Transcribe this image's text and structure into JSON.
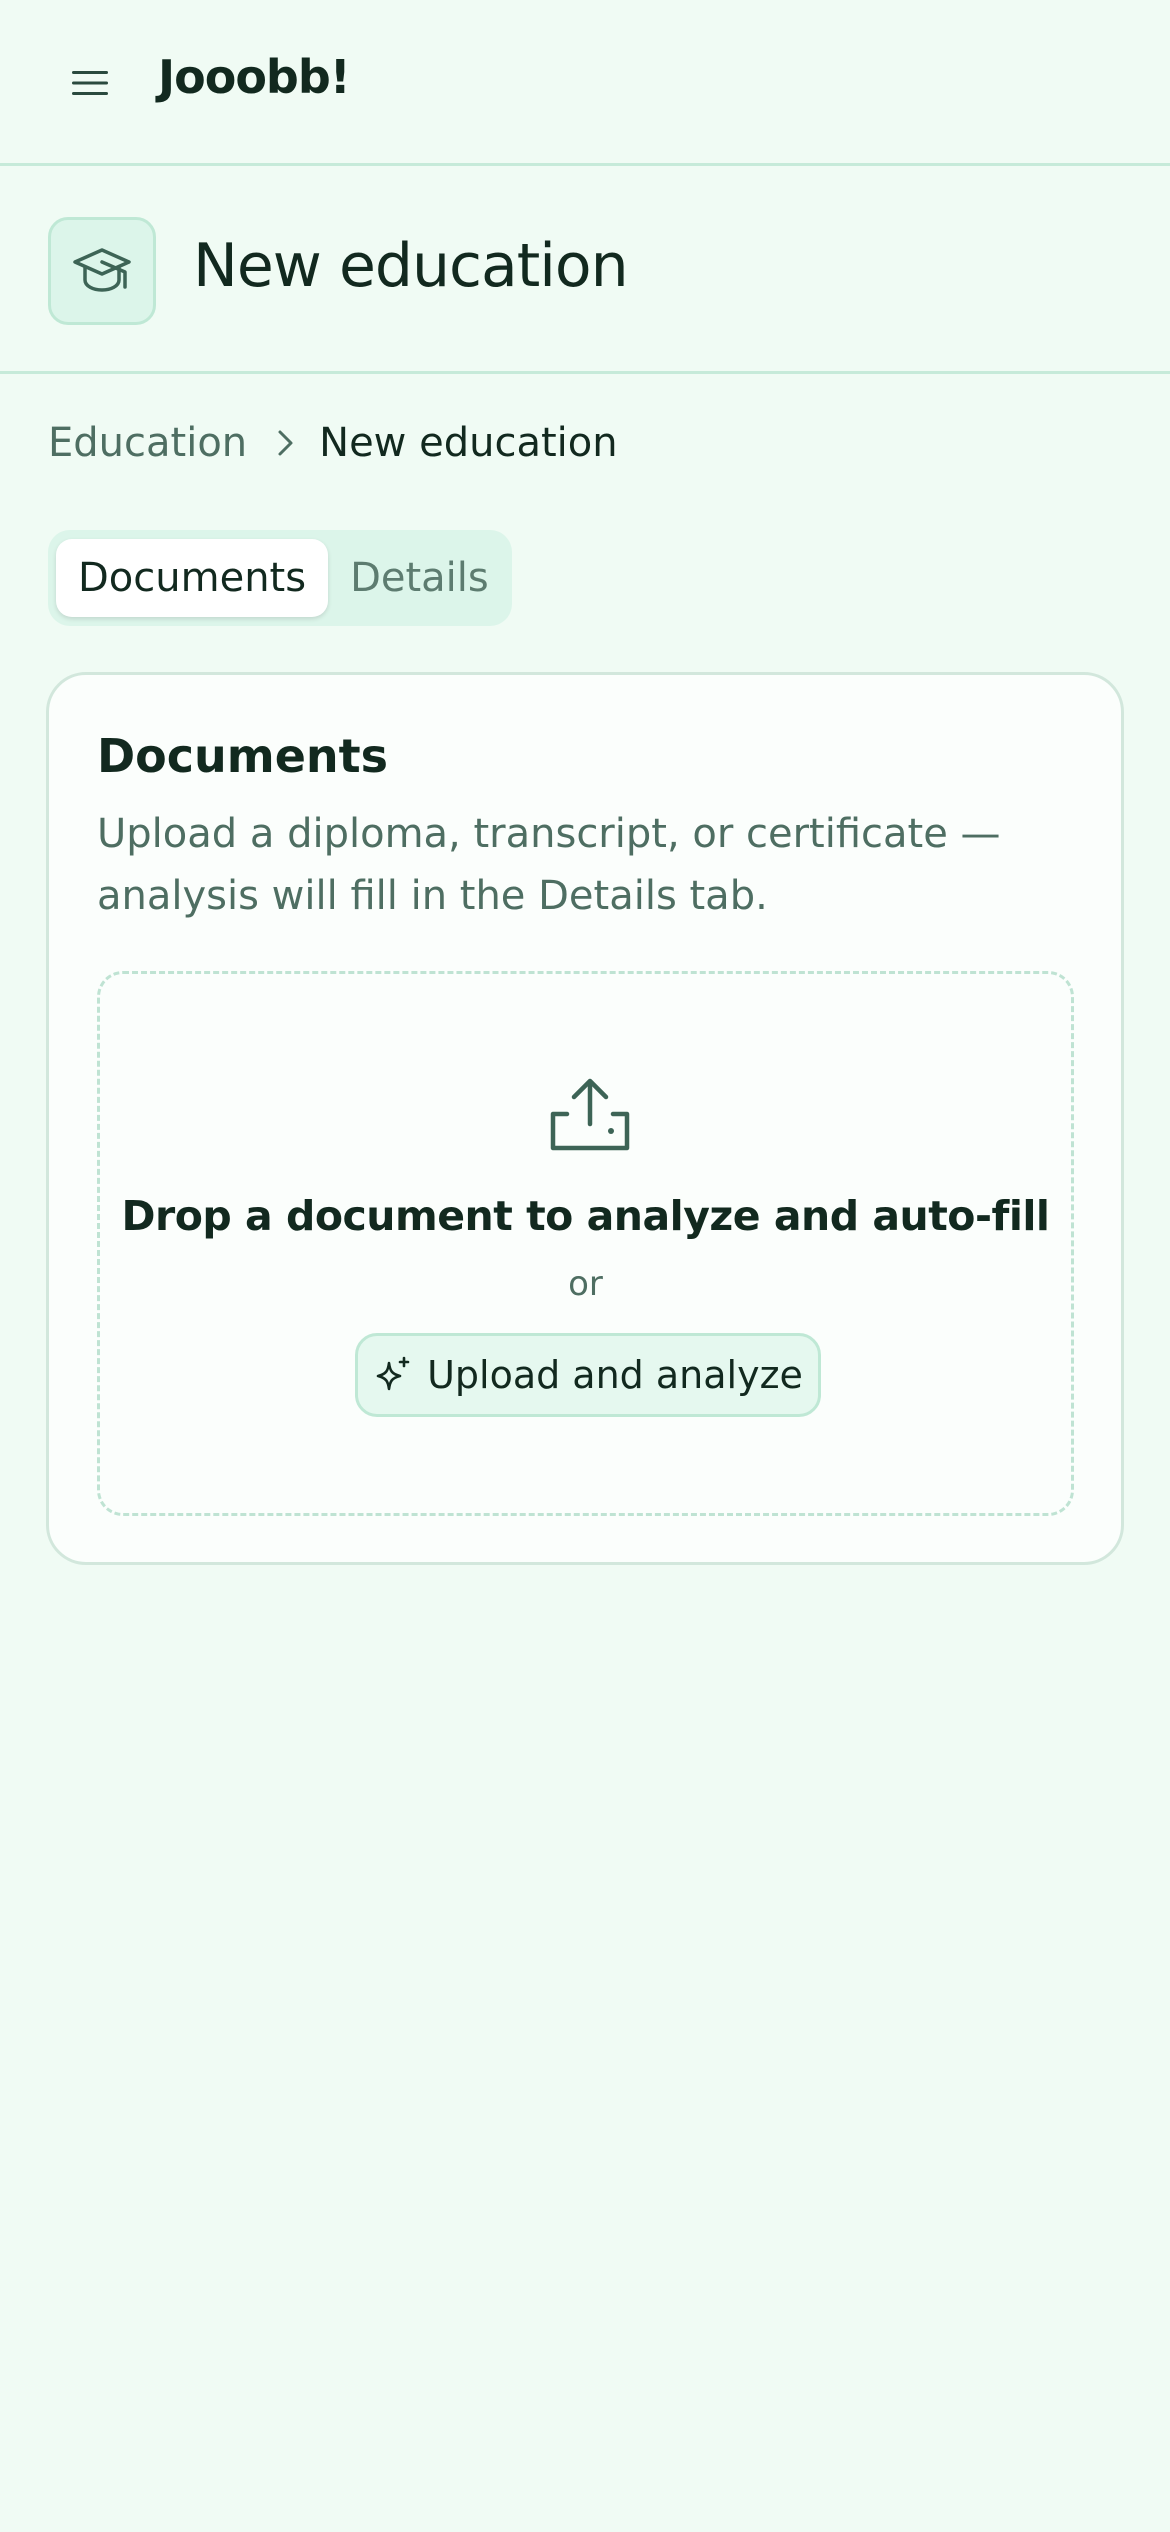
{
  "app": {
    "name": "Jooobb!",
    "menu_icon": "hamburger-menu-icon"
  },
  "header": {
    "icon": "graduation-cap-icon",
    "title": "New education"
  },
  "breadcrumb": {
    "parent": "Education",
    "separator_icon": "chevron-right-icon",
    "current": "New education"
  },
  "tabs": [
    {
      "label": "Documents",
      "active": true
    },
    {
      "label": "Details",
      "active": false
    }
  ],
  "documents_card": {
    "title": "Documents",
    "description": "Upload a diploma, transcript, or certificate — analysis will fill in the Details tab.",
    "dropzone": {
      "icon": "upload-icon",
      "title": "Drop a document to analyze and auto-fill",
      "or_text": "or",
      "button_icon": "sparkle-icon",
      "button_label": "Upload and analyze"
    }
  },
  "colors": {
    "background": "#f0fbf4",
    "border": "#c6ead9",
    "accent_bg": "#dcf5ea",
    "text_primary": "#12291f",
    "text_muted": "#4e6e62",
    "icon": "#3d6456"
  }
}
